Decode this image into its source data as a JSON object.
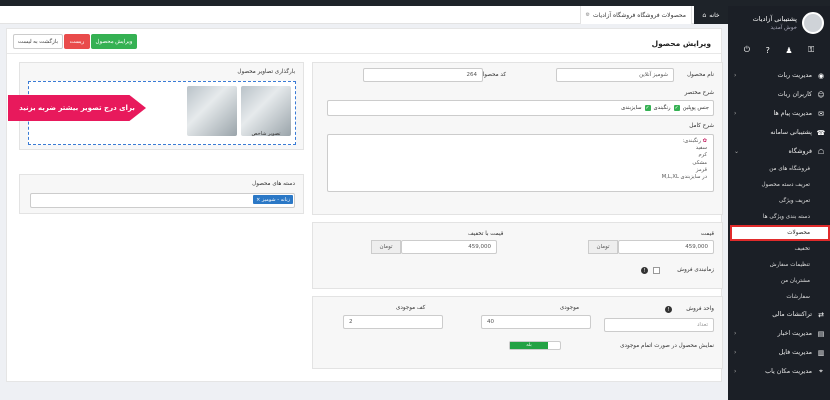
{
  "tabs": {
    "home": "خانه",
    "products": "محصولات فروشگاه فروشگاه آزادیات"
  },
  "user": {
    "name": "پشتیبانی آزادیات",
    "greeting": "خوش آمدید"
  },
  "sidebar": {
    "items": [
      {
        "label": "مدیریت ربات",
        "icon": "robot-icon",
        "chevron": true
      },
      {
        "label": "کاربران ربات",
        "icon": "users-icon",
        "chevron": false
      },
      {
        "label": "مدیریت پیام ها",
        "icon": "message-icon",
        "chevron": true
      },
      {
        "label": "پشتیبانی سامانه",
        "icon": "support-icon",
        "chevron": false
      },
      {
        "label": "فروشگاه",
        "icon": "store-icon",
        "chevron": true
      }
    ],
    "store_sub": [
      "فروشگاه های من",
      "تعریف دسته محصول",
      "تعریف ویژگی",
      "دسته بندی ویژگی ها",
      "محصولات",
      "تخفیف",
      "تنظیمات سفارش",
      "مشتریان من",
      "سفارشات"
    ],
    "active_sub": "محصولات",
    "bottom_items": [
      {
        "label": "تراکنشات مالی",
        "icon": "transactions-icon",
        "chevron": false
      },
      {
        "label": "مدیریت اخبار",
        "icon": "news-icon",
        "chevron": true
      },
      {
        "label": "مدیریت فایل",
        "icon": "file-icon",
        "chevron": true
      },
      {
        "label": "مدیریت مکان یاب",
        "icon": "location-icon",
        "chevron": true
      }
    ]
  },
  "header": {
    "title": "ویرایش محصول",
    "edit_btn": "ویرایش محصول",
    "reset_btn": "ریست",
    "back_btn": "بازگشت به لیست"
  },
  "form": {
    "name_label": "نام محصول",
    "name_value": "شومیز آنلاین",
    "code_label": "کد محصول",
    "code_value": "264",
    "summary_label": "شرح مختصر",
    "summary_prefix": "جنس پوپلین",
    "summary_tags": [
      "رنگبندی",
      "سایزبندی"
    ],
    "full_label": "شرح کامل",
    "full_lines": [
      "رنگبندی:",
      "سفید",
      "کرم",
      "مشکی",
      "قرمز",
      "در سایزبندی M,L,XL"
    ],
    "price_label": "قیمت",
    "price_value": "459,000",
    "price_unit": "تومان",
    "discount_label": "قیمت با تخفیف",
    "discount_value": "459,000",
    "discount_unit": "تومان",
    "timed_label": "زمانبندی فروش",
    "unit_label": "واحد فروش",
    "unit_placeholder": "تعداد",
    "stock_label": "موجودی",
    "stock_value": "40",
    "min_stock_label": "کف موجودی",
    "min_stock_value": "2",
    "show_label": "نمایش محصول در صورت اتمام موجودی",
    "toggle_on": "بله"
  },
  "images": {
    "title": "بارگذاری تصاویر محصول",
    "main_caption": "تصویر شاخص",
    "banner": "برای درج تصویر بیشتر ضربه بزنید"
  },
  "category": {
    "title": "دسته های محصول",
    "tag": "زنانه - شومیز"
  },
  "colors": {
    "sidebar": "#1b1f26",
    "active_outline": "#e02b2b",
    "edit_btn": "#35b153",
    "reset_btn": "#e94b4b",
    "banner": "#e8195c",
    "dropzone": "#3a7bd5"
  }
}
